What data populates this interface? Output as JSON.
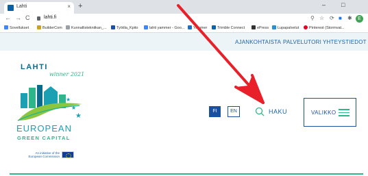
{
  "browser": {
    "tab_title": "Lahti",
    "tab_close": "×",
    "new_tab": "+",
    "window_controls": {
      "minimize": "–",
      "maximize": "□"
    },
    "back": "←",
    "forward": "→",
    "reload": "C",
    "url": "lahti.fi",
    "profile_initial": "E"
  },
  "bookmarks": [
    {
      "label": "Sovellukset",
      "color": "#4285f4"
    },
    {
      "label": "BuilderCom",
      "color": "#c9a227"
    },
    {
      "label": "Kunnallistekniikan_...",
      "color": "#9aa0a6"
    },
    {
      "label": "Työtila_Kpito",
      "color": "#1b4fa0"
    },
    {
      "label": "lahti yammer - Goo...",
      "color": "#4285f4"
    },
    {
      "label": "Yammer",
      "color": "#1f6fbf"
    },
    {
      "label": "Trimble Connect",
      "color": "#0d63a8"
    },
    {
      "label": "ePress",
      "color": "#333333"
    },
    {
      "label": "Lupapalvelut",
      "color": "#2a8fd8"
    },
    {
      "label": "Pinterest (Stormvat...",
      "color": "#e60023"
    }
  ],
  "top_nav": {
    "current": "AJANKOHTAISTA",
    "services": "PALVELUTORI",
    "contact": "YHTEYSTIEDOT"
  },
  "logo": {
    "city": "LAHTI",
    "winner": "winner 2021",
    "european": "EUROPEAN",
    "green_capital": "GREEN CAPITAL",
    "initiative_line1": "An initiative of the",
    "initiative_line2": "European Commission"
  },
  "header": {
    "lang_fi": "FI",
    "lang_en": "EN",
    "search_label": "HAKU",
    "menu_label": "VALIKKO"
  },
  "colors": {
    "brand_blue": "#1b4fa0",
    "brand_green": "#2fb58a",
    "annotation_red": "#e8202a"
  }
}
